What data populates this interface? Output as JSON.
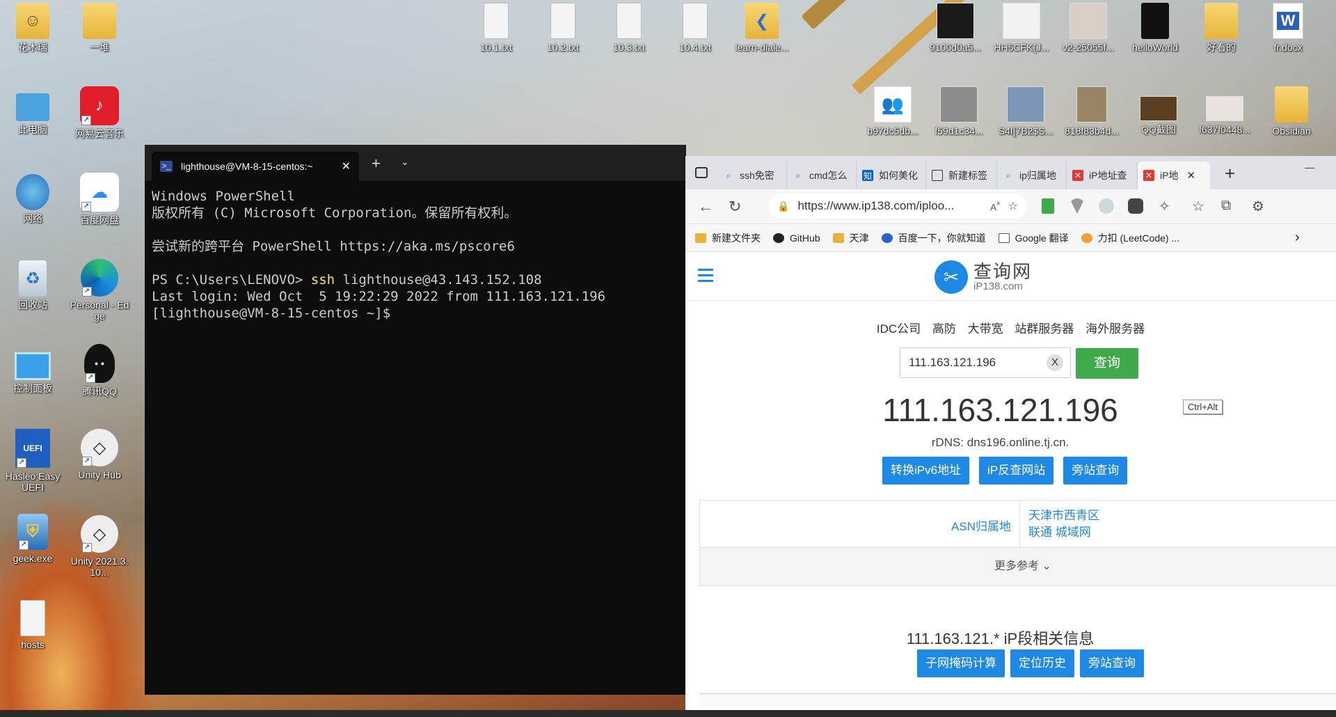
{
  "desktop": {
    "icons": [
      {
        "label": "花木瑞",
        "kind": "folder-user"
      },
      {
        "label": "一堆",
        "kind": "folder-doc"
      },
      {
        "label": "此电脑",
        "kind": "pc"
      },
      {
        "label": "网易云音乐",
        "kind": "netease"
      },
      {
        "label": "网络",
        "kind": "network"
      },
      {
        "label": "百度网盘",
        "kind": "baidu"
      },
      {
        "label": "回收站",
        "kind": "recycle"
      },
      {
        "label": "Personal - Edge",
        "kind": "edge"
      },
      {
        "label": "控制面板",
        "kind": "control"
      },
      {
        "label": "腾讯QQ",
        "kind": "qq"
      },
      {
        "label": "Hasleo EasyUEFI",
        "kind": "uefi"
      },
      {
        "label": "Unity Hub",
        "kind": "unity"
      },
      {
        "label": "geek.exe",
        "kind": "geek"
      },
      {
        "label": "Unity 2021.3.10...",
        "kind": "unity"
      },
      {
        "label": "hosts",
        "kind": "file"
      },
      {
        "label": "10.1.txt",
        "kind": "file"
      },
      {
        "label": "10.2.txt",
        "kind": "file"
      },
      {
        "label": "10.3.txt",
        "kind": "file"
      },
      {
        "label": "10.4.txt",
        "kind": "file"
      },
      {
        "label": "learn-diale...",
        "kind": "folder-vs"
      },
      {
        "label": "9100d0a5...",
        "kind": "thumb"
      },
      {
        "label": "HH5CFK(J...",
        "kind": "thumb"
      },
      {
        "label": "v2-25055f...",
        "kind": "thumb"
      },
      {
        "label": "helloWorld",
        "kind": "folder-dark"
      },
      {
        "label": "好看的",
        "kind": "folder-doc"
      },
      {
        "label": "fr.docx",
        "kind": "word"
      },
      {
        "label": "b97dc5db...",
        "kind": "thumb"
      },
      {
        "label": "f59d1c34...",
        "kind": "thumb"
      },
      {
        "label": "S4I[7B2$S...",
        "kind": "thumb"
      },
      {
        "label": "818f83b4d...",
        "kind": "thumb"
      },
      {
        "label": "QQ截图",
        "kind": "thumb"
      },
      {
        "label": "f637f0448...",
        "kind": "thumb"
      },
      {
        "label": "Obsidian",
        "kind": "folder"
      }
    ]
  },
  "terminal": {
    "tab_title": "lighthouse@VM-8-15-centos:~",
    "tab_close": "✕",
    "new_tab": "+",
    "dropdown": "⌄",
    "lines": [
      {
        "text": "Windows PowerShell"
      },
      {
        "text": "版权所有 (C) Microsoft Corporation。保留所有权利。"
      },
      {
        "text": ""
      },
      {
        "text": "尝试新的跨平台 PowerShell https://aka.ms/pscore6"
      },
      {
        "text": ""
      },
      {
        "prompt": "PS C:\\Users\\LENOVO> ",
        "cmd": "ssh",
        "args": " lighthouse@43.143.152.108"
      },
      {
        "text": "Last login: Wed Oct  5 19:22:29 2022 from 111.163.121.196"
      },
      {
        "text": "[lighthouse@VM-8-15-centos ~]$"
      }
    ]
  },
  "browser": {
    "tabs": [
      {
        "label": "ssh免密",
        "fav": "🔍",
        "color": "#ffffff"
      },
      {
        "label": "cmd怎么",
        "fav": "🔍",
        "color": "#ffffff"
      },
      {
        "label": "如何美化",
        "fav": "知",
        "color": "#0a66c2"
      },
      {
        "label": "新建标签",
        "fav": "▣",
        "color": "#ffffff"
      },
      {
        "label": "ip归属地",
        "fav": "🔍",
        "color": "#ffffff"
      },
      {
        "label": "iP地址查",
        "fav": "✕",
        "color": "#e53935"
      }
    ],
    "active_tab": {
      "label": "iP地",
      "close": "✕"
    },
    "new_tab": "+",
    "minimize": "—",
    "url": "https://www.ip138.com/iploo...",
    "bookmarks": [
      {
        "label": "新建文件夹",
        "color": "#e9b23a"
      },
      {
        "label": "GitHub",
        "color": "#222222"
      },
      {
        "label": "天津",
        "color": "#e9b23a"
      },
      {
        "label": "百度一下，你就知道",
        "color": "#2f5fd0"
      },
      {
        "label": "Google 翻译",
        "color": "#ffffff"
      },
      {
        "label": "力扣 (LeetCode) ...",
        "color": "#f4a030"
      }
    ],
    "bookmarks_more": "›"
  },
  "site": {
    "logo_main": "查询网",
    "logo_sub": "iP138.com",
    "nav": [
      "IDC公司",
      "高防",
      "大带宽",
      "站群服务器",
      "海外服务器"
    ],
    "search_value": "111.163.121.196",
    "clear": "X",
    "query_btn": "查询",
    "ip": "111.163.121.196",
    "kbd_hint": "Ctrl+Alt",
    "rdns": "rDNS: dns196.online.tj.cn.",
    "buttons": [
      "转换iPv6地址",
      "iP反查网站",
      "旁站查询"
    ],
    "asn_key": "ASN归属地",
    "asn_val1": "天津市西青区",
    "asn_val2": "联通 城域网",
    "more": "更多参考 ⌄",
    "seg_title": "111.163.121.* iP段相关信息",
    "seg_buttons": [
      "子网掩码计算",
      "定位历史",
      "旁站查询"
    ]
  }
}
